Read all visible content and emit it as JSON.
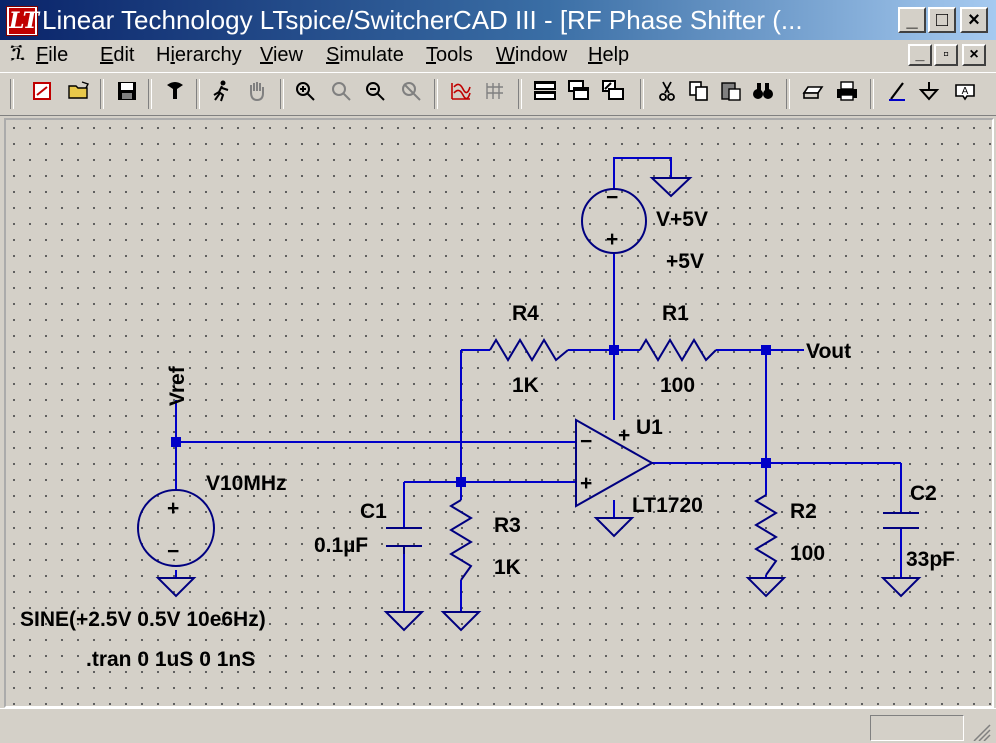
{
  "window": {
    "title": "Linear Technology LTspice/SwitcherCAD III - [RF Phase Shifter (...",
    "app_icon": "LT",
    "buttons": {
      "minimize": "_",
      "maximize": "□",
      "close": "×"
    }
  },
  "menubar": {
    "items": [
      {
        "label": "File",
        "accel": "F"
      },
      {
        "label": "Edit",
        "accel": "E"
      },
      {
        "label": "Hierarchy",
        "accel": "i"
      },
      {
        "label": "View",
        "accel": "V"
      },
      {
        "label": "Simulate",
        "accel": "S"
      },
      {
        "label": "Tools",
        "accel": "T"
      },
      {
        "label": "Window",
        "accel": "W"
      },
      {
        "label": "Help",
        "accel": "H"
      }
    ],
    "mdi_buttons": {
      "minimize": "_",
      "restore": "▫",
      "close": "×"
    }
  },
  "toolbar": {
    "icons": [
      "new-schematic-icon",
      "open-icon",
      "save-icon",
      "control-panel-icon",
      "run-icon",
      "halt-icon",
      "zoom-in-icon",
      "pan-icon",
      "zoom-out-icon",
      "zoom-fit-icon",
      "autorange-icon",
      "grid-icon",
      "tile-horizontal-icon",
      "cascade-icon",
      "tile-vertical-icon",
      "cut-icon",
      "copy-icon",
      "paste-icon",
      "find-icon",
      "print-setup-icon",
      "print-icon",
      "draw-wire-icon",
      "ground-icon",
      "label-net-icon"
    ]
  },
  "schematic": {
    "components": {
      "vsupply_name": "V+5V",
      "vsupply_value": "+5V",
      "r4_name": "R4",
      "r4_value": "1K",
      "r1_name": "R1",
      "r1_value": "100",
      "u1_name": "U1",
      "u1_model": "LT1720",
      "vsig_name": "V10MHz",
      "c1_name": "C1",
      "c1_value": "0.1µF",
      "r3_name": "R3",
      "r3_value": "1K",
      "r2_name": "R2",
      "r2_value": "100",
      "c2_name": "C2",
      "c2_value": "33pF"
    },
    "nets": {
      "vref": "Vref",
      "vout": "Vout"
    },
    "directives": {
      "sine": "SINE(+2.5V 0.5V 10e6Hz)",
      "tran": ".tran 0 1uS 0 1nS"
    },
    "opamp_pins": {
      "plus_top": "+",
      "minus": "−",
      "plus": "+"
    },
    "source_signs": {
      "plus": "+",
      "minus": "−"
    },
    "wire_color": "#0000c8",
    "part_color": "#000080"
  },
  "statusbar": {
    "text": ""
  }
}
